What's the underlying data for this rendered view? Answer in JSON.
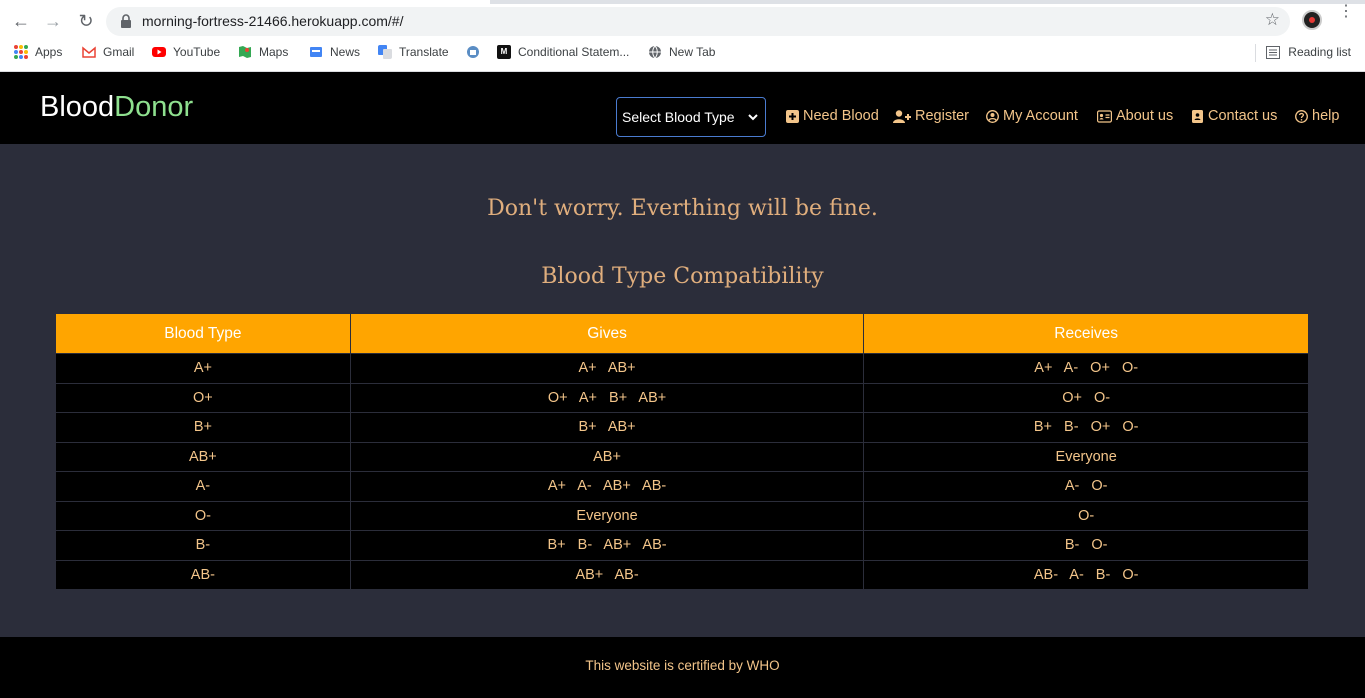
{
  "browser": {
    "url": "morning-fortress-21466.herokuapp.com/#/",
    "bookmarks": [
      {
        "label": "Apps",
        "icon": "apps-icon"
      },
      {
        "label": "Gmail",
        "icon": "gmail-icon"
      },
      {
        "label": "YouTube",
        "icon": "youtube-icon"
      },
      {
        "label": "Maps",
        "icon": "maps-icon"
      },
      {
        "label": "News",
        "icon": "news-icon"
      },
      {
        "label": "Translate",
        "icon": "translate-icon"
      },
      {
        "label": "",
        "icon": "bookmark-icon"
      },
      {
        "label": "Conditional Statem...",
        "icon": "codecademy-icon"
      },
      {
        "label": "New Tab",
        "icon": "globe-icon"
      }
    ],
    "reading_list": "Reading list"
  },
  "header": {
    "brand_part1": "Blood",
    "brand_part2": "Donor",
    "select_value": "Select Blood Type",
    "nav": {
      "need_blood": "Need Blood",
      "register": "Register",
      "my_account": "My Account",
      "about_us": "About us",
      "contact_us": "Contact us",
      "help": "help"
    }
  },
  "main": {
    "tagline": "Don't worry. Everthing will be fine.",
    "compat_title": "Blood Type Compatibility",
    "columns": [
      "Blood Type",
      "Gives",
      "Receives"
    ],
    "rows": [
      [
        "A+",
        "A+ AB+",
        "A+ A- O+ O-"
      ],
      [
        "O+",
        "O+ A+ B+ AB+",
        "O+ O-"
      ],
      [
        "B+",
        "B+ AB+",
        "B+ B- O+ O-"
      ],
      [
        "AB+",
        "AB+",
        "Everyone"
      ],
      [
        "A-",
        "A+ A- AB+ AB-",
        "A- O-"
      ],
      [
        "O-",
        "Everyone",
        "O-"
      ],
      [
        "B-",
        "B+ B- AB+ AB-",
        "B- O-"
      ],
      [
        "AB-",
        "AB+ AB-",
        "AB- A- B- O-"
      ]
    ]
  },
  "footer": {
    "text": "This website is certified by WHO"
  },
  "colors": {
    "accent": "#ffa500",
    "text_gold": "#f3c58a",
    "brand_green": "#8fe08f",
    "background": "#2b2d3a"
  }
}
